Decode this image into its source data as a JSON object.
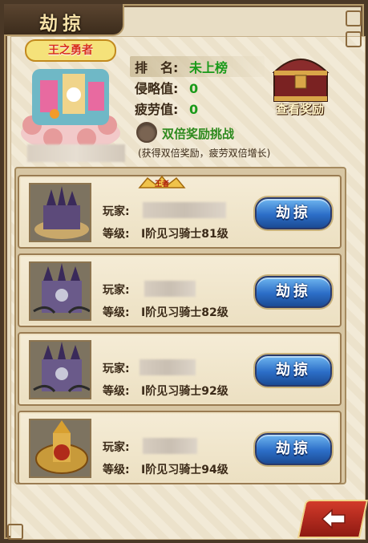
{
  "title": "劫掠",
  "logo": {
    "text": "王之勇者"
  },
  "stats": {
    "rank_label": "排　名:",
    "rank_value": "未上榜",
    "invasion_label": "侵略值:",
    "invasion_value": "0",
    "fatigue_label": "疲劳值:",
    "fatigue_value": "0"
  },
  "reward_button": "查看奖励",
  "double_challenge": {
    "label": "双倍奖励挑战",
    "note": "(获得双倍奖励，疲劳双倍增长)"
  },
  "player_label": "玩家:",
  "level_label": "等级:",
  "rob_button": "劫掠",
  "badge_text": "王者",
  "opponents": [
    {
      "level": "Ⅰ阶见习骑士81级"
    },
    {
      "level": "Ⅰ阶见习骑士82级"
    },
    {
      "level": "Ⅰ阶见习骑士92级"
    },
    {
      "level": "Ⅰ阶见习骑士94级"
    }
  ],
  "colors": {
    "accent_green": "#1a9a1a",
    "button_blue": "#2c6ec7",
    "frame_brown": "#4a3826"
  },
  "icons": [
    "castle-icon",
    "chest-icon",
    "back-icon"
  ]
}
